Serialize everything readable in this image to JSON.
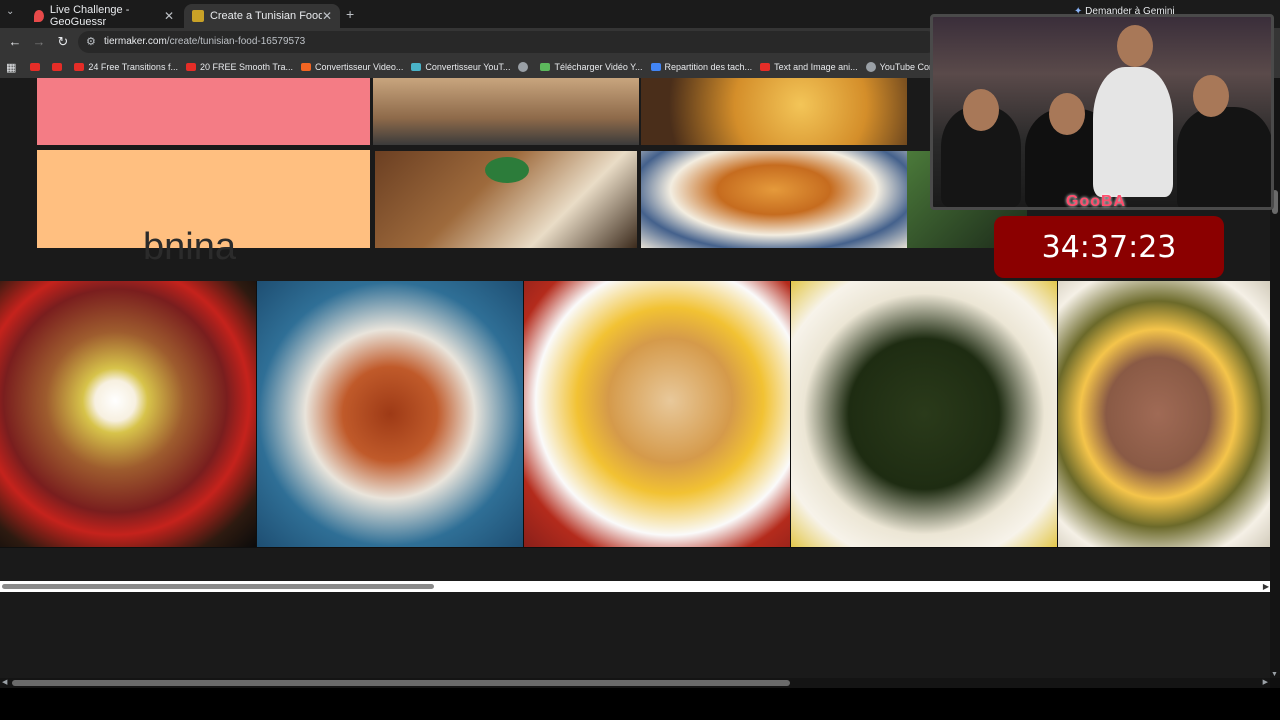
{
  "browser": {
    "tabs": [
      {
        "title": "Live Challenge - GeoGuessr",
        "active": false
      },
      {
        "title": "Create a Tunisian Food Tier List",
        "active": true
      }
    ],
    "gemini_label": "Demander à Gemini",
    "url_host": "tiermaker.com",
    "url_path": "/create/tunisian-food-16579573",
    "bookmarks": [
      {
        "label": "",
        "color": "#e52d27"
      },
      {
        "label": "",
        "color": "#e52d27"
      },
      {
        "label": "24 Free Transitions f...",
        "color": "#e52d27"
      },
      {
        "label": "20 FREE Smooth Tra...",
        "color": "#e52d27"
      },
      {
        "label": "Convertisseur Video...",
        "color": "#f26522"
      },
      {
        "label": "Convertisseur YouT...",
        "color": "#4ab3c8"
      },
      {
        "label": "",
        "color": "#9aa0a6"
      },
      {
        "label": "Télécharger Vidéo Y...",
        "color": "#5cb85c"
      },
      {
        "label": "Repartition des tach...",
        "color": "#4285f4"
      },
      {
        "label": "Text and Image ani...",
        "color": "#e52d27"
      },
      {
        "label": "YouTube Converter...",
        "color": "#9aa0a6"
      }
    ]
  },
  "tier_list": {
    "partial_label": "bnina",
    "tier_colors": {
      "pink": "#f47c85",
      "orange": "#ffbf80"
    }
  },
  "overlay": {
    "stream_tag": "GooBA",
    "timer": "34:37:23",
    "timer_color": "#8b0000"
  },
  "icons": {
    "back": "arrow-left-icon",
    "forward": "arrow-right-icon",
    "reload": "reload-icon",
    "site_info": "tune-icon",
    "apps": "apps-grid-icon"
  }
}
